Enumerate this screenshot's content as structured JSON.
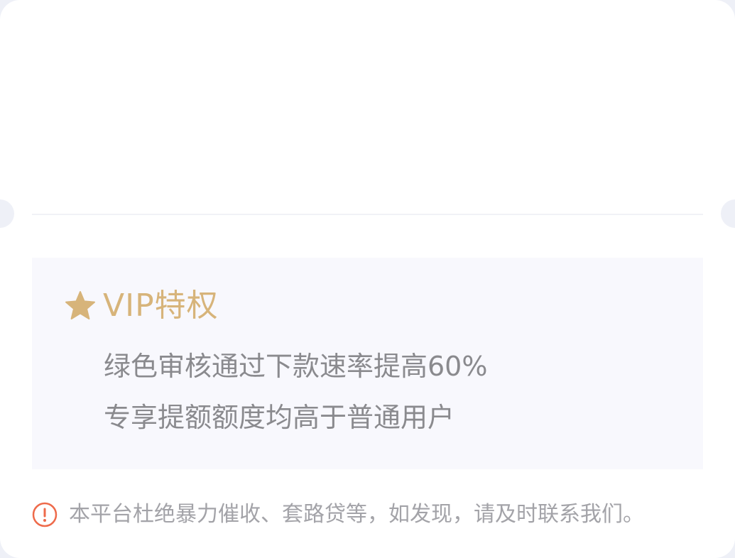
{
  "vip": {
    "title": "VIP特权",
    "icon": "star-icon",
    "accent_color": "#d7b47a",
    "benefits": [
      "绿色审核通过下款速率提高60%",
      "专享提额额度均高于普通用户"
    ]
  },
  "notice": {
    "icon": "warning-icon",
    "icon_color": "#ee6a4a",
    "text": "本平台杜绝暴力催收、套路贷等，如发现，请及时联系我们。"
  }
}
